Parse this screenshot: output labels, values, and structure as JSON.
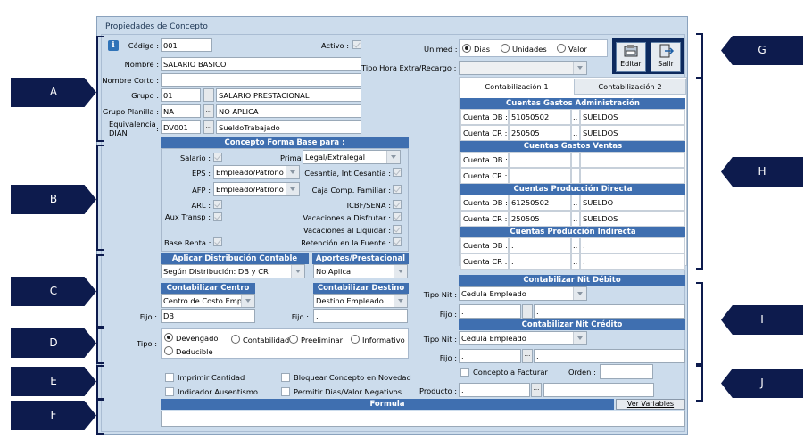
{
  "window": {
    "title": "Propiedades de Concepto"
  },
  "header": {
    "codigo_label": "Código :",
    "codigo": "001",
    "activo_label": "Activo :",
    "nombre_label": "Nombre :",
    "nombre": "SALARIO BASICO",
    "nombre_corto_label": "Nombre Corto :",
    "nombre_corto": "",
    "grupo_label": "Grupo :",
    "grupo_code": "01",
    "grupo_name": "SALARIO PRESTACIONAL",
    "grupo_planilla_label": "Grupo Planilla :",
    "grupo_planilla_code": "NA",
    "grupo_planilla_name": "NO APLICA",
    "equivalencia_label_1": "Equivalencia",
    "equivalencia_label_2": "DIAN",
    "equivalencia_colon": ":",
    "equivalencia_code": "DV001",
    "equivalencia_name": "SueldoTrabajado",
    "more_btn": "..."
  },
  "unimed": {
    "label": "Unimed :",
    "options": [
      "Dias",
      "Unidades",
      "Valor"
    ],
    "selected": "Dias"
  },
  "tipo_hora": {
    "label": "Tipo Hora Extra/Recargo :",
    "value": ""
  },
  "toolbar": {
    "edit_label": "Editar",
    "exit_label": "Salir"
  },
  "base": {
    "title": "Concepto Forma Base para :",
    "salario": "Salario :",
    "prima": "Prima :",
    "prima_value": "Legal/Extralegal",
    "eps": "EPS :",
    "eps_value": "Empleado/Patrono",
    "cesantia": "Cesantía, Int Cesantía :",
    "afp": "AFP :",
    "afp_value": "Empleado/Patrono",
    "caja": "Caja Comp. Familiar :",
    "arl": "ARL :",
    "icbf": "ICBF/SENA :",
    "aux": "Aux Transp :",
    "vac_disfrutar": "Vacaciones a Disfrutar :",
    "vac_liquidar": "Vacaciones al Liquidar :",
    "base_renta": "Base Renta :",
    "retencion": "Retención en la Fuente :"
  },
  "distribucion": {
    "title": "Aplicar Distribución Contable",
    "value": "Según Distribución: DB y CR"
  },
  "aportes": {
    "title": "Aportes/Prestacional",
    "value": "No Aplica"
  },
  "centro": {
    "title": "Contabilizar Centro",
    "value": "Centro de Costo Emple",
    "fijo_label": "Fijo :",
    "fijo": "DB"
  },
  "destino": {
    "title": "Contabilizar Destino",
    "value": "Destino Empleado",
    "fijo_label": "Fijo :",
    "fijo": "."
  },
  "tipo": {
    "label": "Tipo :",
    "options": [
      "Devengado",
      "Contabilidad",
      "Preeliminar",
      "Informativo",
      "Deducible"
    ],
    "selected": "Devengado"
  },
  "flags": {
    "imprimir": "Imprimir Cantidad",
    "bloquear": "Bloquear Concepto en Novedad",
    "ausentismo": "Indicador Ausentismo",
    "permitir": "Permitir Dias/Valor Negativos"
  },
  "formula": {
    "title": "Formula",
    "ver_variables": "Ver Variables",
    "value": ""
  },
  "contabilizacion": {
    "tabs": [
      "Contabilización 1",
      "Contabilización 2"
    ],
    "sections": [
      {
        "title": "Cuentas Gastos Administración",
        "rows": [
          {
            "label": "Cuenta DB :",
            "code": "51050502",
            "sep": "..",
            "name": "SUELDOS"
          },
          {
            "label": "Cuenta CR :",
            "code": "250505",
            "sep": "..",
            "name": "SUELDOS"
          }
        ]
      },
      {
        "title": "Cuentas Gastos Ventas",
        "rows": [
          {
            "label": "Cuenta DB :",
            "code": ".",
            "sep": "..",
            "name": "."
          },
          {
            "label": "Cuenta CR :",
            "code": ".",
            "sep": "..",
            "name": "."
          }
        ]
      },
      {
        "title": "Cuentas Producción Directa",
        "rows": [
          {
            "label": "Cuenta DB :",
            "code": "61250502",
            "sep": "..",
            "name": "SUELDO"
          },
          {
            "label": "Cuenta CR :",
            "code": "250505",
            "sep": "..",
            "name": "SUELDOS"
          }
        ]
      },
      {
        "title": "Cuentas Producción Indirecta",
        "rows": [
          {
            "label": "Cuenta DB :",
            "code": ".",
            "sep": "..",
            "name": "."
          },
          {
            "label": "Cuenta CR :",
            "code": ".",
            "sep": "..",
            "name": "."
          }
        ]
      }
    ]
  },
  "nit_debito": {
    "title": "Contabilizar Nit Débito",
    "tipo_label": "Tipo Nit :",
    "tipo": "Cedula Empleado",
    "fijo_label": "Fijo :",
    "fijo_code": ".",
    "fijo_name": "."
  },
  "nit_credito": {
    "title": "Contabilizar Nit Crédito",
    "tipo_label": "Tipo Nit :",
    "tipo": "Cedula Empleado",
    "fijo_label": "Fijo :",
    "fijo_code": ".",
    "fijo_name": "."
  },
  "facturar": {
    "label": "Concepto a Facturar",
    "orden_label": "Orden :",
    "orden": "",
    "producto_label": "Producto :",
    "producto_code": ".",
    "producto_name": ""
  },
  "callouts": [
    "A",
    "B",
    "C",
    "D",
    "E",
    "F",
    "G",
    "H",
    "I",
    "J"
  ],
  "colors": {
    "navy": "#0d1b4d",
    "header_blue": "#3f6fb0",
    "panel": "#ccdcec"
  }
}
